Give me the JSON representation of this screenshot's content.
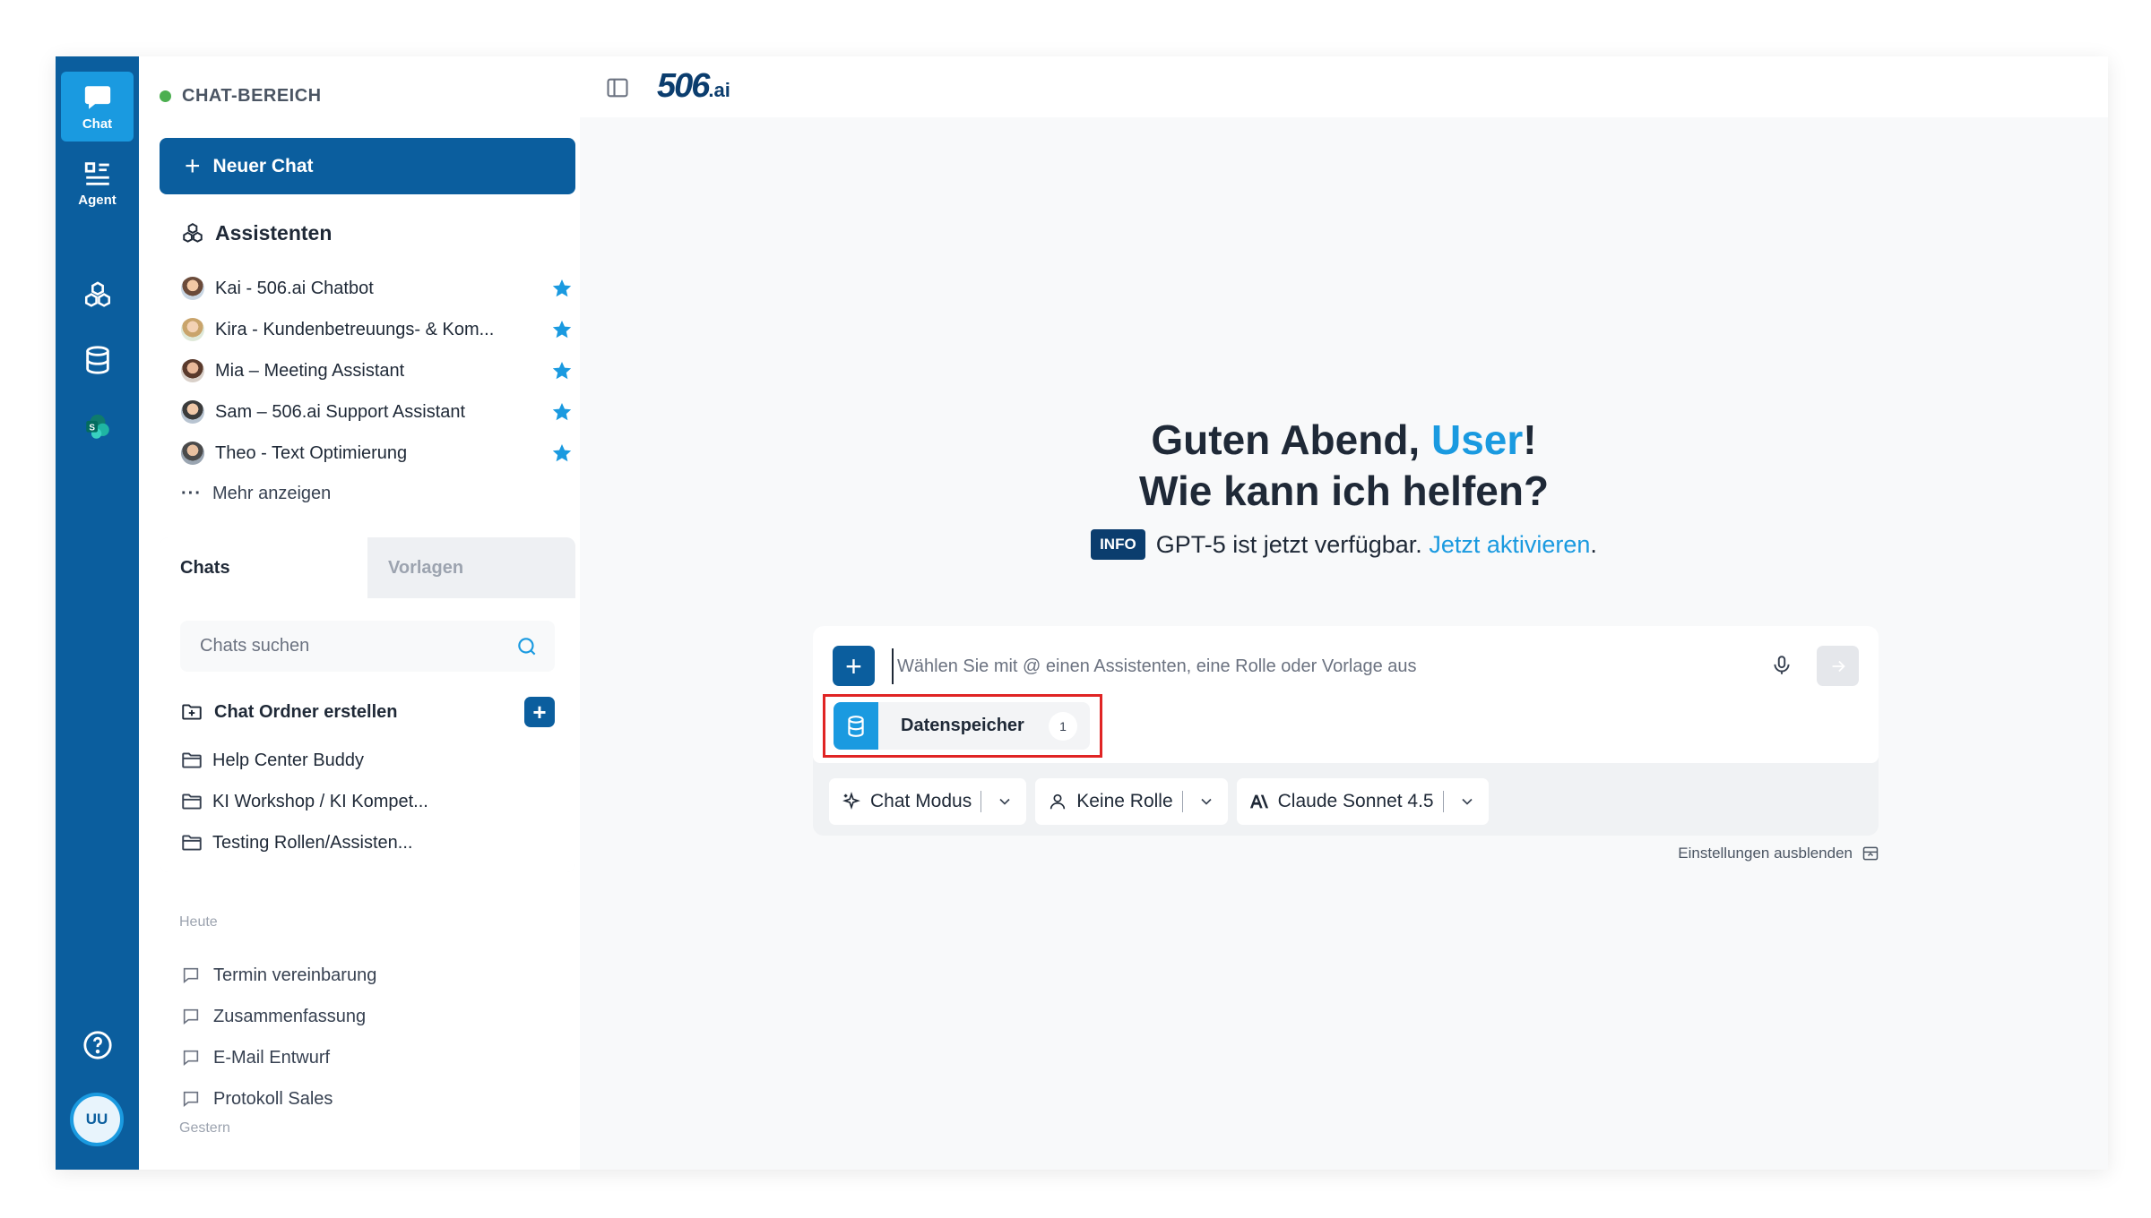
{
  "rail": {
    "items": [
      {
        "label": "Chat",
        "icon": "chat-bubble-icon",
        "active": true
      },
      {
        "label": "Agent",
        "icon": "agent-list-icon"
      },
      {
        "label": "",
        "icon": "cubes-icon"
      },
      {
        "label": "",
        "icon": "database-icon"
      },
      {
        "label": "",
        "icon": "sharepoint-icon"
      }
    ],
    "help_icon": "help-circle-icon",
    "avatar_initials": "UU"
  },
  "sidebar": {
    "header": "CHAT-BEREICH",
    "new_chat_label": "Neuer Chat",
    "assistants_title": "Assistenten",
    "assistants": [
      {
        "name": "Kai - 506.ai Chatbot",
        "starred": true
      },
      {
        "name": "Kira - Kundenbetreuungs- & Kom...",
        "starred": true
      },
      {
        "name": "Mia – Meeting Assistant",
        "starred": true
      },
      {
        "name": "Sam – 506.ai Support Assistant",
        "starred": true
      },
      {
        "name": "Theo - Text Optimierung",
        "starred": true
      }
    ],
    "more_label": "Mehr anzeigen",
    "tabs": [
      {
        "label": "Chats",
        "active": true
      },
      {
        "label": "Vorlagen",
        "active": false
      }
    ],
    "search_placeholder": "Chats suchen",
    "create_folder_label": "Chat Ordner erstellen",
    "folders": [
      "Help Center Buddy",
      "KI Workshop / KI Kompet...",
      "Testing Rollen/Assisten..."
    ],
    "today_label": "Heute",
    "today_chats": [
      "Termin vereinbarung",
      "Zusammenfassung",
      "E-Mail Entwurf",
      "Protokoll Sales"
    ],
    "yesterday_label": "Gestern"
  },
  "main": {
    "logo_main": "506",
    "logo_suffix": ".ai",
    "greeting_prefix": "Guten Abend, ",
    "greeting_user": "User",
    "greeting_suffix": "!",
    "greeting_line2": "Wie kann ich helfen?",
    "info_badge": "INFO",
    "info_text": "GPT-5 ist jetzt verfügbar.",
    "info_link": "Jetzt aktivieren",
    "info_end": ".",
    "composer": {
      "placeholder": "Wählen Sie mit @ einen Assistenten, eine Rolle oder Vorlage aus",
      "datastore_label": "Datenspeicher",
      "datastore_count": "1",
      "options": [
        {
          "label": "Chat Modus",
          "icon": "sparkle-icon"
        },
        {
          "label": "Keine Rolle",
          "icon": "person-icon"
        },
        {
          "label": "Claude Sonnet 4.5",
          "icon": "anthropic-icon"
        }
      ]
    },
    "settings_hide_label": "Einstellungen ausblenden",
    "colors": {
      "brand": "#0b5e9e",
      "accent": "#1a9ae0",
      "highlight": "#e02424"
    }
  }
}
